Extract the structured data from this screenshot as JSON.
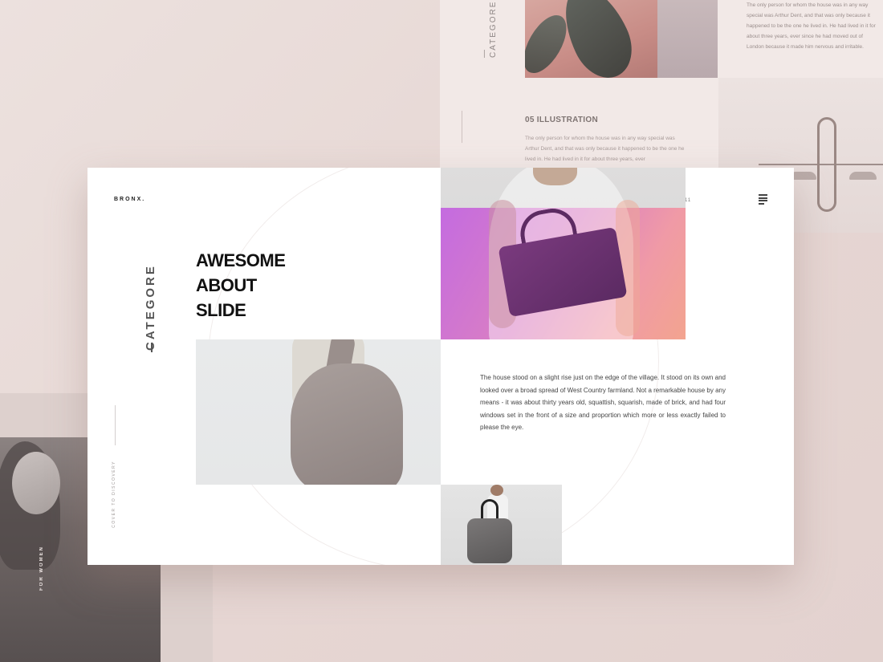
{
  "background": {
    "top_vertical_label": "— CATEGORE",
    "top_paragraph": "The only person for whom the house was in any way special was Arthur Dent, and that was only because it happened to be the one he lived in. He had lived in it for about three years, ever since he had moved out of London because it made him nervous and irritable.",
    "section_title": "05 ILLUSTRATION",
    "section_paragraph": "The only person for whom the house was in any way special was Arthur Dent, and that was only because it happened to be the one he lived in. He had lived in it for about three years, ever",
    "left_photo_label": "FOR WOMEN"
  },
  "slide": {
    "logo": "BRONX.",
    "page_number": "11",
    "category_label": "CATEGORE",
    "headline": [
      "AWESOME",
      "ABOUT",
      "SLIDE"
    ],
    "side_vertical_text": "COVER TO DISCOVERY",
    "body_text": "The house stood on a slight rise just on the edge of the village. It stood on its own and looked over a broad spread of West Country farmland. Not a remarkable house by any means - it was about thirty years old, squattish, squarish, made of brick, and had four windows set in the front of a size and proportion which more or less exactly failed to please the eye."
  },
  "icons": {
    "menu": "menu-icon"
  },
  "colors": {
    "background": "#e9dcd9",
    "slide": "#ffffff",
    "accent_gradient_start": "#c46be0",
    "accent_gradient_end": "#f3a48f",
    "headline": "#111111"
  }
}
